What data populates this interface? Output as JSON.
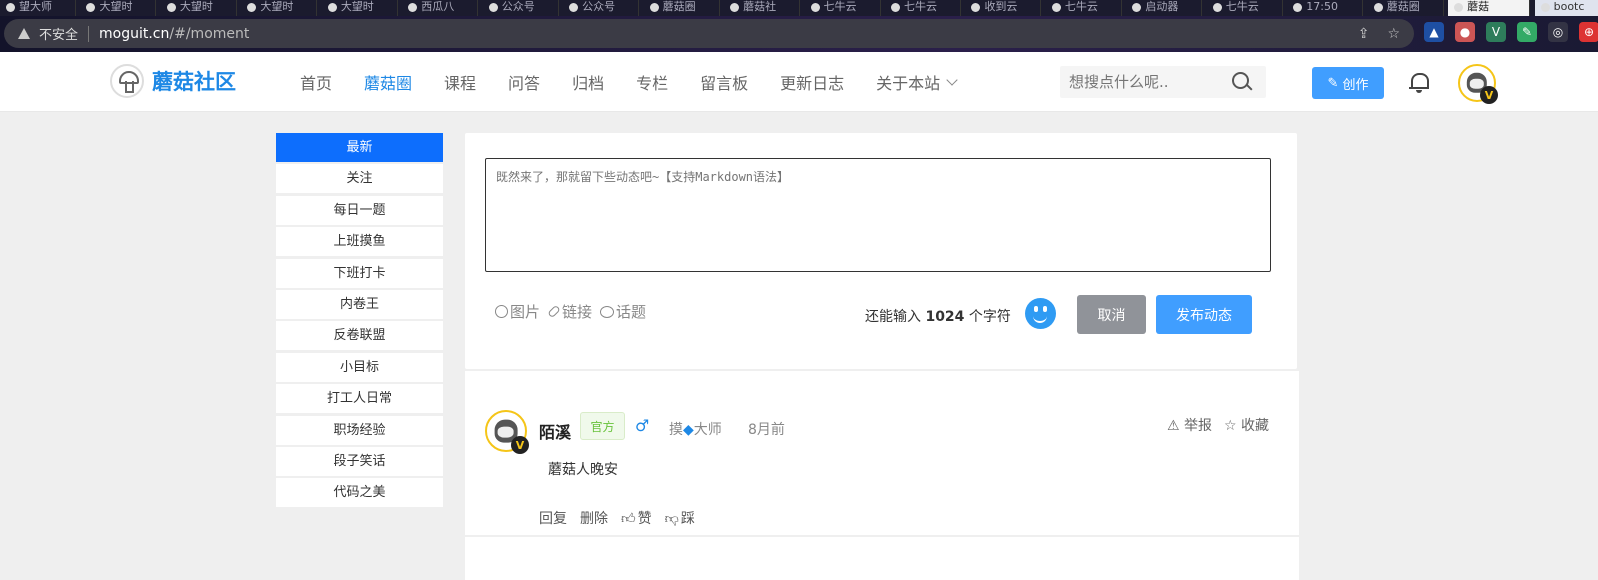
{
  "browser": {
    "tabs": [
      {
        "label": "望大师"
      },
      {
        "label": "大望时"
      },
      {
        "label": "大望时"
      },
      {
        "label": "大望时"
      },
      {
        "label": "大望时"
      },
      {
        "label": "西瓜八"
      },
      {
        "label": "公众号"
      },
      {
        "label": "公众号"
      },
      {
        "label": "蘑菇圈"
      },
      {
        "label": "蘑菇社"
      },
      {
        "label": "七牛云"
      },
      {
        "label": "七牛云"
      },
      {
        "label": "收到云"
      },
      {
        "label": "七牛云"
      },
      {
        "label": "启动器"
      },
      {
        "label": "七牛云"
      },
      {
        "label": "17:50"
      },
      {
        "label": "蘑菇圈"
      },
      {
        "label": "蘑菇"
      },
      {
        "label": "bootc"
      }
    ],
    "security_label": "不安全",
    "url_host": "moguit.cn",
    "url_path": "/#/moment"
  },
  "header": {
    "logo_text": "蘑菇社区",
    "nav": [
      "首页",
      "蘑菇圈",
      "课程",
      "问答",
      "归档",
      "专栏",
      "留言板",
      "更新日志",
      "关于本站"
    ],
    "search_placeholder": "想搜点什么呢..",
    "create_label": "创作",
    "avatar_badge": "V"
  },
  "sidebar": {
    "items": [
      "最新",
      "关注",
      "每日一题",
      "上班摸鱼",
      "下班打卡",
      "内卷王",
      "反卷联盟",
      "小目标",
      "打工人日常",
      "职场经验",
      "段子笑话",
      "代码之美"
    ]
  },
  "composer": {
    "placeholder": "既然来了，那就留下些动态吧~【支持Markdown语法】",
    "tools": [
      "图片",
      "链接",
      "话题"
    ],
    "counter_prefix": "还能输入",
    "counter_value": "1024",
    "counter_suffix": "个字符",
    "cancel_label": "取消",
    "publish_label": "发布动态"
  },
  "post": {
    "author": "陌溪",
    "badge": "官方",
    "gender_symbol": "♂",
    "level_prefix": "摸",
    "level_suffix": "大师",
    "time": "8月前",
    "report_label": "举报",
    "favorite_label": "收藏",
    "content": "蘑菇人晚安",
    "reply_label": "回复",
    "delete_label": "删除",
    "like_label": "赞",
    "dislike_label": "踩",
    "avatar_badge": "V"
  },
  "colors": {
    "brand": "#1e88e5",
    "primary_button": "#409eff",
    "sidebar_active": "#0d6efd",
    "cancel_button": "#909399"
  }
}
